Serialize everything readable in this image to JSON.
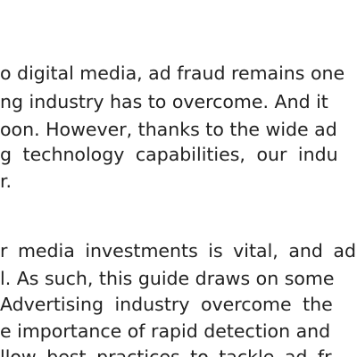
{
  "document": {
    "paragraph_1": [
      "o digital media, ad fraud remains one",
      "ng industry has to overcome. And it",
      "oon. However, thanks to the wide ad",
      "g technology capabilities, our indu",
      "r."
    ],
    "paragraph_2": [
      "r media investments is vital, and ad",
      "l. As such, this guide draws on some",
      "Advertising industry overcome the",
      "e importance of rapid detection and",
      "llow best practices to tackle ad fr"
    ]
  }
}
